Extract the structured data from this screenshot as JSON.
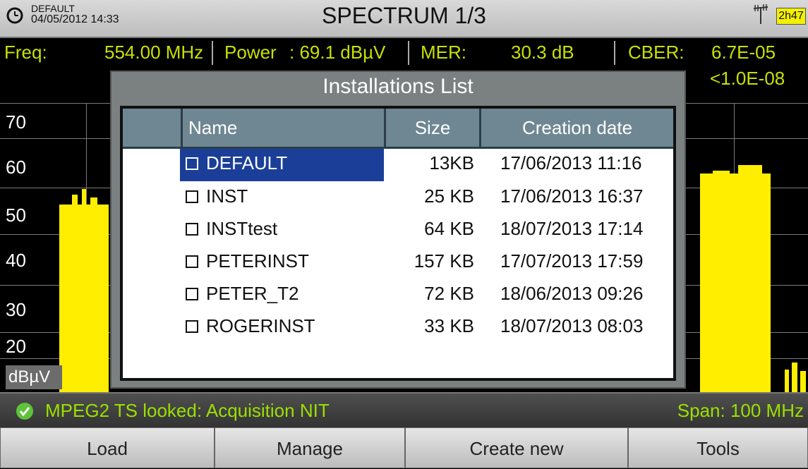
{
  "header": {
    "installation": "DEFAULT",
    "datetime": "04/05/2012 14:33",
    "title": "SPECTRUM 1/3",
    "battery": "2h47",
    "icons": [
      "clock-icon",
      "antenna-icon",
      "battery-icon"
    ]
  },
  "measurements": {
    "freq_label": "Freq:",
    "freq_value": "554.00 MHz",
    "power_label": "Power",
    "power_value": ": 69.1 dBµV",
    "mer_label": "MER:",
    "mer_value": "30.3 dB",
    "cber_label": "CBER:",
    "cber_value": "6.7E-05",
    "vber_value": "<1.0E-08"
  },
  "spectrum": {
    "y_ticks": [
      "70",
      "60",
      "50",
      "40",
      "30",
      "20"
    ],
    "unit": "dBµV"
  },
  "dialog": {
    "title": "Installations List",
    "columns": [
      "Name",
      "Size",
      "Creation date"
    ],
    "rows": [
      {
        "name": "DEFAULT",
        "size": "13KB",
        "date": "17/06/2013 11:16",
        "selected": true
      },
      {
        "name": "INST",
        "size": "25 KB",
        "date": "17/06/2013 16:37"
      },
      {
        "name": "INSTtest",
        "size": "64 KB",
        "date": "18/07/2013 17:14"
      },
      {
        "name": "PETERINST",
        "size": "157 KB",
        "date": "17/07/2013 17:59"
      },
      {
        "name": "PETER_T2",
        "size": "72 KB",
        "date": "18/06/2013 09:26"
      },
      {
        "name": "ROGERINST",
        "size": "33 KB",
        "date": "18/07/2013 08:03"
      }
    ]
  },
  "status": {
    "message": "MPEG2  TS looked: Acquisition NIT",
    "span": "Span: 100 MHz"
  },
  "softkeys": [
    "Load",
    "Manage",
    "Create new",
    "Tools"
  ],
  "colors": {
    "measurement_text": "#c8e000",
    "status_text": "#9be000",
    "spectrum_trace": "#ffee00",
    "selection": "#1b3f98"
  }
}
